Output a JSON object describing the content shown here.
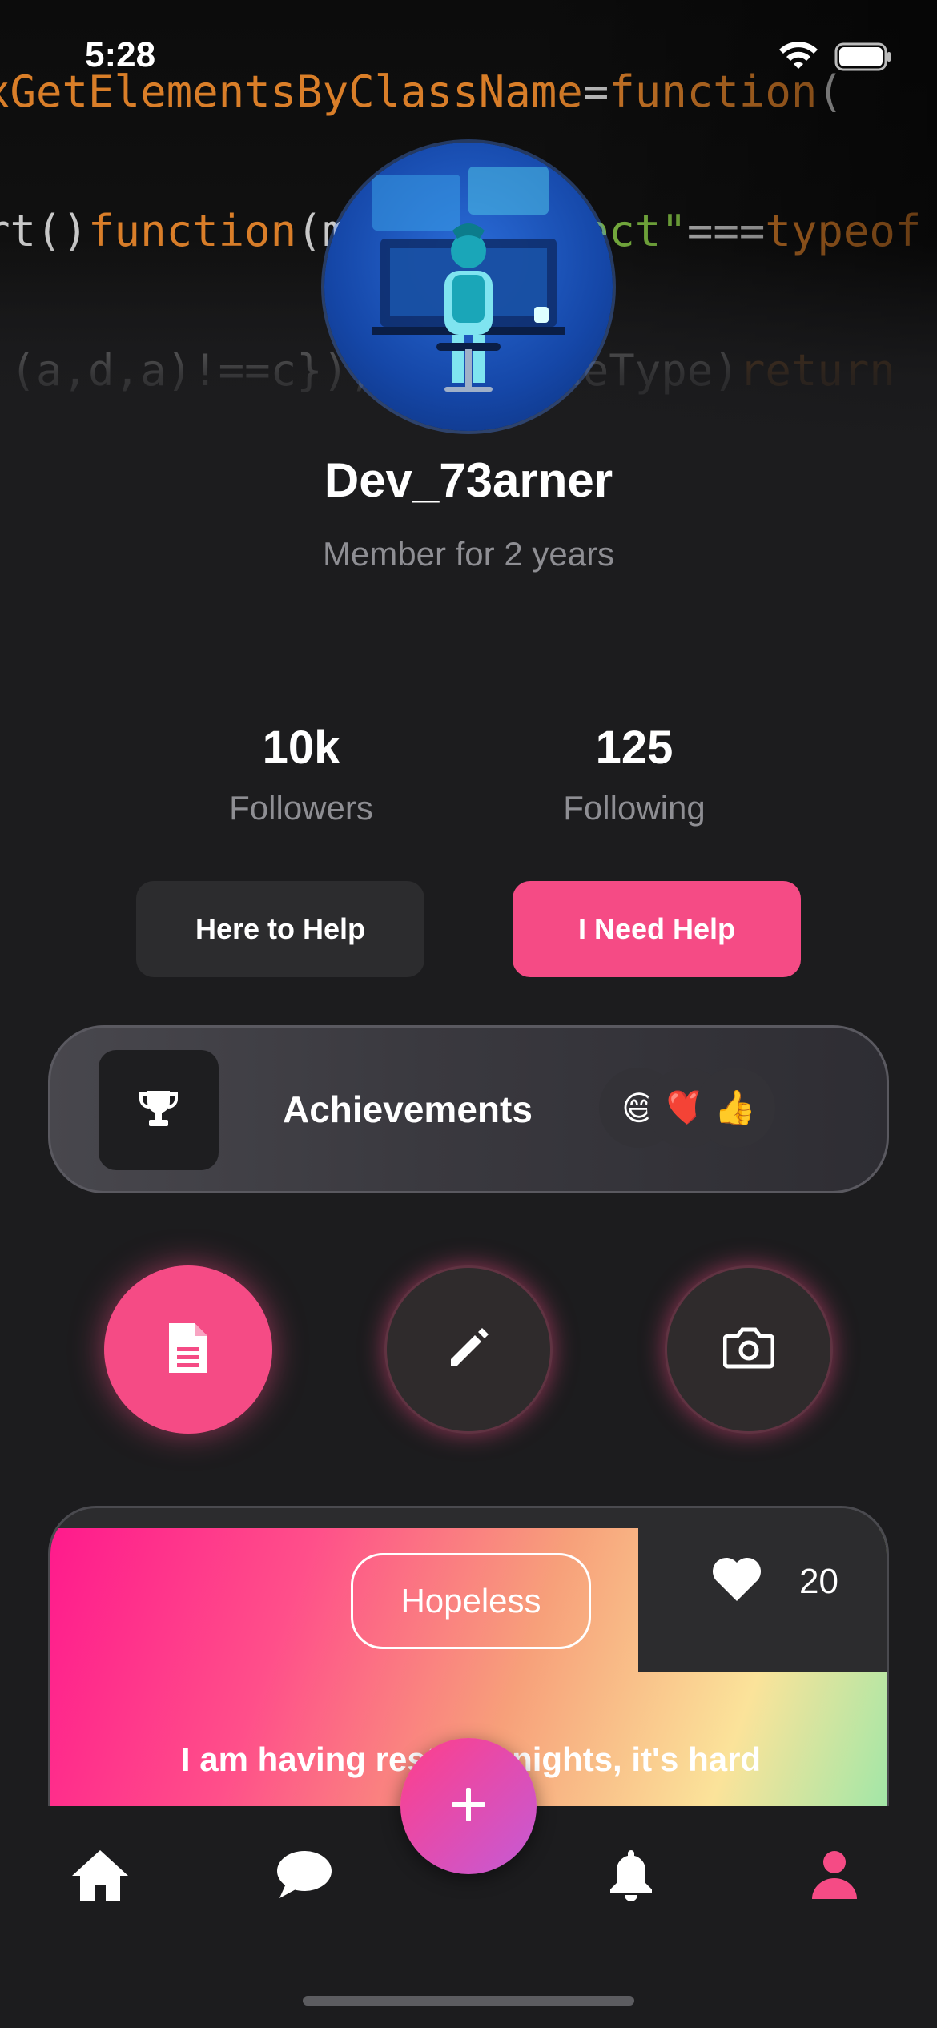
{
  "status_bar": {
    "time": "5:28"
  },
  "profile": {
    "username": "Dev_73arner",
    "member_since": "Member for 2 years"
  },
  "stats": [
    {
      "value": "10k",
      "label": "Followers"
    },
    {
      "value": "125",
      "label": "Following"
    }
  ],
  "actions": {
    "here_to_help": "Here to Help",
    "need_help": "I Need Help"
  },
  "achievements": {
    "label": "Achievements",
    "emojis": [
      "😄",
      "❤️",
      "👍"
    ]
  },
  "quick_actions": [
    "document-icon",
    "pencil-icon",
    "camera-icon"
  ],
  "post": {
    "mood": "Hopeless",
    "likes": "20",
    "text": "I am having restless nights, it's hard"
  },
  "colors": {
    "accent": "#f54b85",
    "background": "#1c1c1e",
    "card": "#2c2c2e"
  },
  "tabbar": [
    "home-icon",
    "chat-icon",
    "add-icon",
    "bell-icon",
    "profile-icon"
  ]
}
